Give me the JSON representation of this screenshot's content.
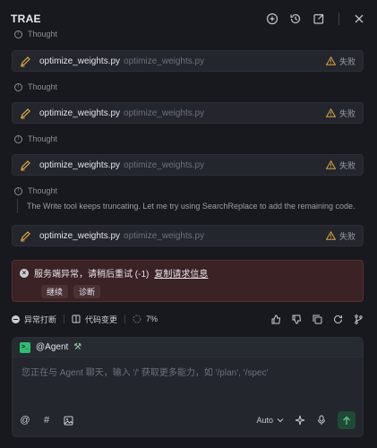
{
  "header": {
    "title": "TRAE"
  },
  "thoughts": [
    {
      "label": "Thought"
    },
    {
      "label": "Thought"
    },
    {
      "label": "Thought"
    },
    {
      "label": "Thought"
    }
  ],
  "thought_note": "The Write tool keeps truncating. Let me try using SearchReplace to add the remaining code.",
  "files": [
    {
      "name": "optimize_weights.py",
      "path": "optimize_weights.py",
      "status": "失败"
    },
    {
      "name": "optimize_weights.py",
      "path": "optimize_weights.py",
      "status": "失败"
    },
    {
      "name": "optimize_weights.py",
      "path": "optimize_weights.py",
      "status": "失败"
    },
    {
      "name": "optimize_weights.py",
      "path": "optimize_weights.py",
      "status": "失败"
    }
  ],
  "error": {
    "message": "服务端异常，请稍后重试 (-1)",
    "link": "复制请求信息",
    "buttons": [
      "继续",
      "诊断"
    ]
  },
  "status_bar": {
    "interrupt": "异常打断",
    "code_changes": "代码变更",
    "progress": "7%"
  },
  "input": {
    "agent": "@Agent",
    "placeholder": "您正在与 Agent 聊天，输入 '/' 获取更多能力，如 '/plan', '/spec'",
    "model": "Auto"
  },
  "colors": {
    "accent": "#2fbf71",
    "warning": "#e0a93a",
    "error_bg": "#3b2224"
  }
}
